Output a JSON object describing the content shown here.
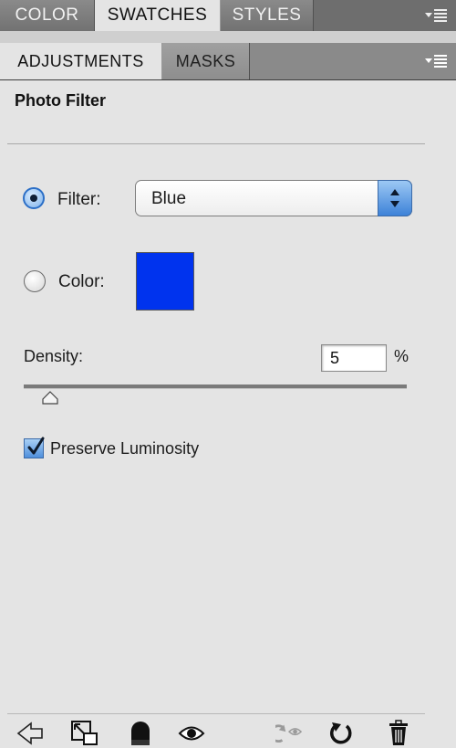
{
  "top_tabs": [
    {
      "label": "COLOR",
      "active": false
    },
    {
      "label": "SWATCHES",
      "active": true
    },
    {
      "label": "STYLES",
      "active": false
    }
  ],
  "second_tabs": [
    {
      "label": "ADJUSTMENTS",
      "active": true
    },
    {
      "label": "MASKS",
      "active": false
    }
  ],
  "panel": {
    "title": "Photo Filter",
    "filter": {
      "label": "Filter:",
      "selected": "Blue",
      "checked": true
    },
    "color": {
      "label": "Color:",
      "swatch": "#0033ee",
      "checked": false
    },
    "density": {
      "label": "Density:",
      "value": "5",
      "unit": "%",
      "slider_percent": 5
    },
    "preserve_luminosity": {
      "label": "Preserve Luminosity",
      "checked": true
    }
  },
  "footer_icons": [
    "back-arrow-icon",
    "expand-view-icon",
    "clip-to-layer-icon",
    "visibility-eye-icon",
    "view-previous-state-icon",
    "reset-icon",
    "trash-icon"
  ],
  "colors": {
    "tab_bar": "#6e6e6e",
    "panel_bg": "#e4e4e4",
    "accent_blue": "#3d82d8"
  }
}
